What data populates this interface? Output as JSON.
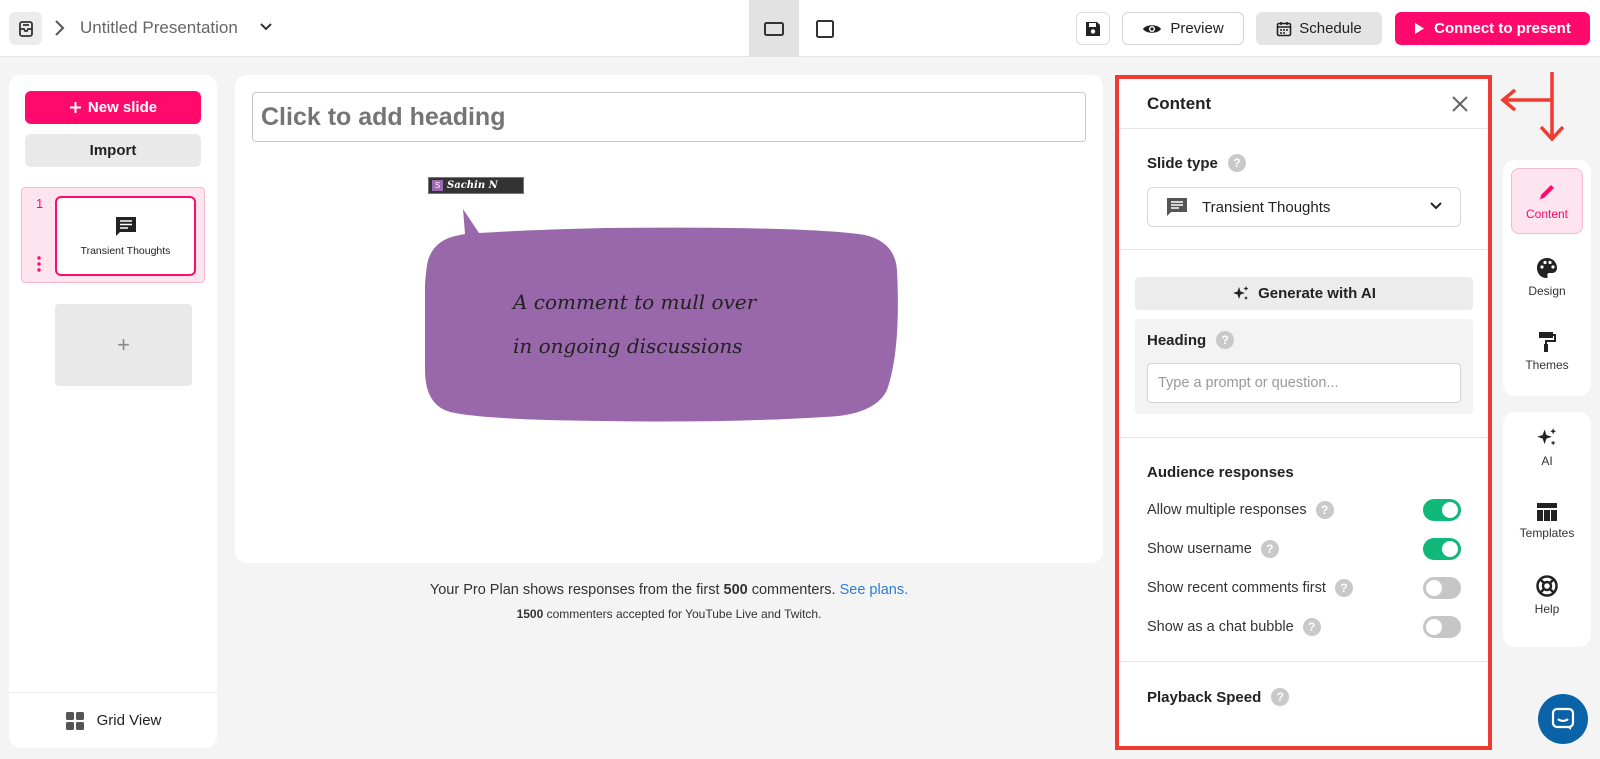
{
  "topbar": {
    "title": "Untitled Presentation",
    "preview_label": "Preview",
    "schedule_label": "Schedule",
    "connect_label": "Connect to present"
  },
  "sidebar": {
    "new_slide_label": "New slide",
    "import_label": "Import",
    "slides": [
      {
        "number": "1",
        "label": "Transient Thoughts"
      }
    ],
    "add_symbol": "+",
    "grid_view_label": "Grid View"
  },
  "canvas": {
    "heading_placeholder": "Click to add heading",
    "commenter_initial": "S",
    "commenter_name": "Sachin N",
    "comment_line1": "A comment to mull over",
    "comment_line2": "in ongoing discussions",
    "bubble_color": "#9868aa"
  },
  "plan_note": {
    "prefix": "Your Pro Plan shows responses from the first ",
    "count": "500",
    "suffix": " commenters. ",
    "link": "See plans.",
    "sub_count": "1500",
    "sub_text": " commenters accepted for YouTube Live and Twitch."
  },
  "content_panel": {
    "title": "Content",
    "slide_type_label": "Slide type",
    "slide_type_value": "Transient Thoughts",
    "generate_label": "Generate with AI",
    "heading_label": "Heading",
    "prompt_placeholder": "Type a prompt or question...",
    "audience_label": "Audience responses",
    "toggles": [
      {
        "label": "Allow multiple responses",
        "on": true
      },
      {
        "label": "Show username",
        "on": true
      },
      {
        "label": "Show recent comments first",
        "on": false
      },
      {
        "label": "Show as a chat bubble",
        "on": false
      }
    ],
    "playback_label": "Playback Speed"
  },
  "right_nav": {
    "content": "Content",
    "design": "Design",
    "themes": "Themes",
    "ai": "AI",
    "templates": "Templates",
    "help": "Help"
  },
  "colors": {
    "accent": "#ff0a6c",
    "toggle_on": "#10b87a",
    "highlight_border": "#f03b30"
  }
}
